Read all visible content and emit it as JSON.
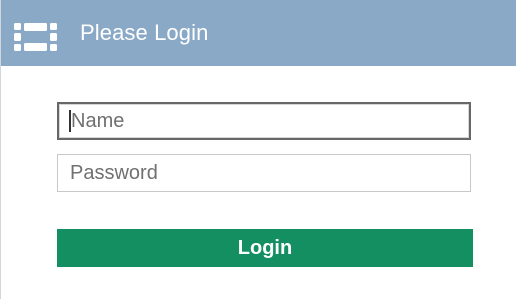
{
  "dialog": {
    "title": "Please Login",
    "logo_icon": "fortinet-grid-logo-icon"
  },
  "form": {
    "name": {
      "value": "",
      "placeholder": "Name"
    },
    "password": {
      "value": "",
      "placeholder": "Password"
    },
    "submit_label": "Login"
  },
  "colors": {
    "header_background": "#89a9c6",
    "button_background": "#138f61",
    "button_text": "#ffffff"
  }
}
